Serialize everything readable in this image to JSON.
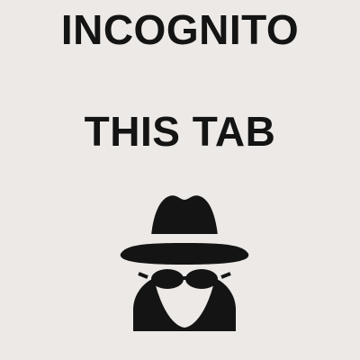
{
  "tile": {
    "line1": "INCOGNITO",
    "line2": "THIS TAB",
    "icon": "incognito-spy-icon"
  },
  "colors": {
    "background": "#ece9e6",
    "ink": "#141414"
  }
}
